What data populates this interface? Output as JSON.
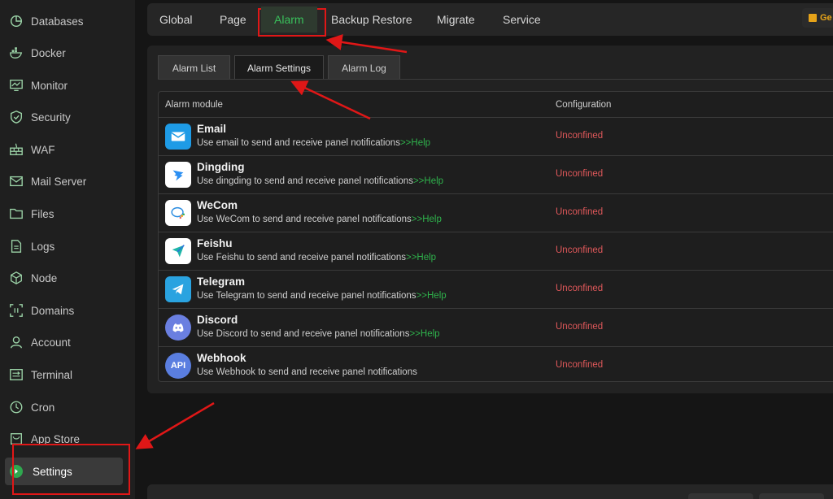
{
  "sidebar": {
    "items": [
      {
        "label": "Databases",
        "icon": "database-icon"
      },
      {
        "label": "Docker",
        "icon": "docker-icon"
      },
      {
        "label": "Monitor",
        "icon": "monitor-icon"
      },
      {
        "label": "Security",
        "icon": "shield-icon"
      },
      {
        "label": "WAF",
        "icon": "firewall-icon"
      },
      {
        "label": "Mail Server",
        "icon": "mail-icon"
      },
      {
        "label": "Files",
        "icon": "folder-icon"
      },
      {
        "label": "Logs",
        "icon": "logs-icon"
      },
      {
        "label": "Node",
        "icon": "node-cube-icon"
      },
      {
        "label": "Domains",
        "icon": "domains-icon"
      },
      {
        "label": "Account",
        "icon": "user-icon"
      },
      {
        "label": "Terminal",
        "icon": "terminal-icon"
      },
      {
        "label": "Cron",
        "icon": "clock-icon"
      },
      {
        "label": "App Store",
        "icon": "store-icon"
      },
      {
        "label": "Settings",
        "icon": "settings-icon",
        "active": true
      }
    ]
  },
  "top_tabs": [
    {
      "label": "Global"
    },
    {
      "label": "Page"
    },
    {
      "label": "Alarm",
      "active": true
    },
    {
      "label": "Backup Restore"
    },
    {
      "label": "Migrate"
    },
    {
      "label": "Service"
    }
  ],
  "get_button": {
    "label": "Ge"
  },
  "sub_tabs": [
    {
      "label": "Alarm List"
    },
    {
      "label": "Alarm Settings",
      "active": true
    },
    {
      "label": "Alarm Log"
    }
  ],
  "table": {
    "headers": {
      "module": "Alarm module",
      "configuration": "Configuration"
    },
    "rows": [
      {
        "name": "Email",
        "description": "Use email to send and receive panel notifications",
        "help": ">>Help",
        "status": "Unconfined",
        "icon": "email-icon"
      },
      {
        "name": "Dingding",
        "description": "Use dingding to send and receive panel notifications",
        "help": ">>Help",
        "status": "Unconfined",
        "icon": "dingding-icon"
      },
      {
        "name": "WeCom",
        "description": "Use WeCom to send and receive panel notifications",
        "help": ">>Help",
        "status": "Unconfined",
        "icon": "wecom-icon"
      },
      {
        "name": "Feishu",
        "description": "Use Feishu to send and receive panel notifications",
        "help": ">>Help",
        "status": "Unconfined",
        "icon": "feishu-icon"
      },
      {
        "name": "Telegram",
        "description": "Use Telegram to send and receive panel notifications",
        "help": ">>Help",
        "status": "Unconfined",
        "icon": "telegram-icon"
      },
      {
        "name": "Discord",
        "description": "Use Discord to send and receive panel notifications",
        "help": ">>Help",
        "status": "Unconfined",
        "icon": "discord-icon"
      },
      {
        "name": "Webhook",
        "description": "Use Webhook to send and receive panel notifications",
        "help": "",
        "status": "Unconfined",
        "icon": "api-icon",
        "icon_text": "API"
      }
    ]
  },
  "colors": {
    "accent_green": "#39c05b",
    "status_red": "#e0585a",
    "annotation_red": "#e01717"
  }
}
